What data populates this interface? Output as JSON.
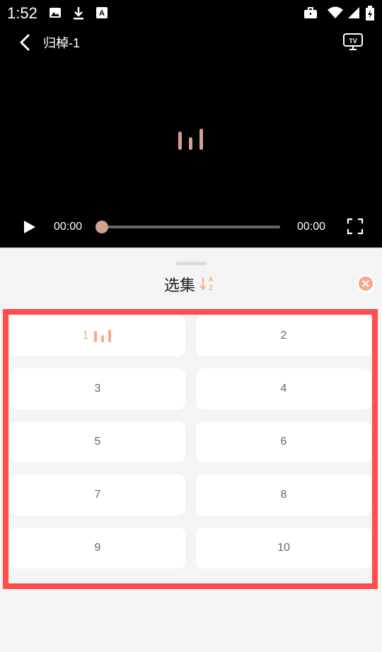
{
  "status_bar": {
    "time": "1:52"
  },
  "video": {
    "title": "归棹-1",
    "current_time": "00:00",
    "total_time": "00:00",
    "progress": 0
  },
  "episode_sheet": {
    "title": "选集",
    "episodes": [
      "1",
      "2",
      "3",
      "4",
      "5",
      "6",
      "7",
      "8",
      "9",
      "10"
    ],
    "active_episode": "1"
  },
  "colors": {
    "accent": "#f6a98c",
    "highlight_border": "#ff4d4d"
  },
  "icons": {
    "back": "back-icon",
    "tv": "tv-cast-icon",
    "loading": "loading-bars-icon",
    "play": "play-icon",
    "fullscreen": "fullscreen-icon",
    "sort": "sort-icon",
    "close": "close-icon"
  }
}
